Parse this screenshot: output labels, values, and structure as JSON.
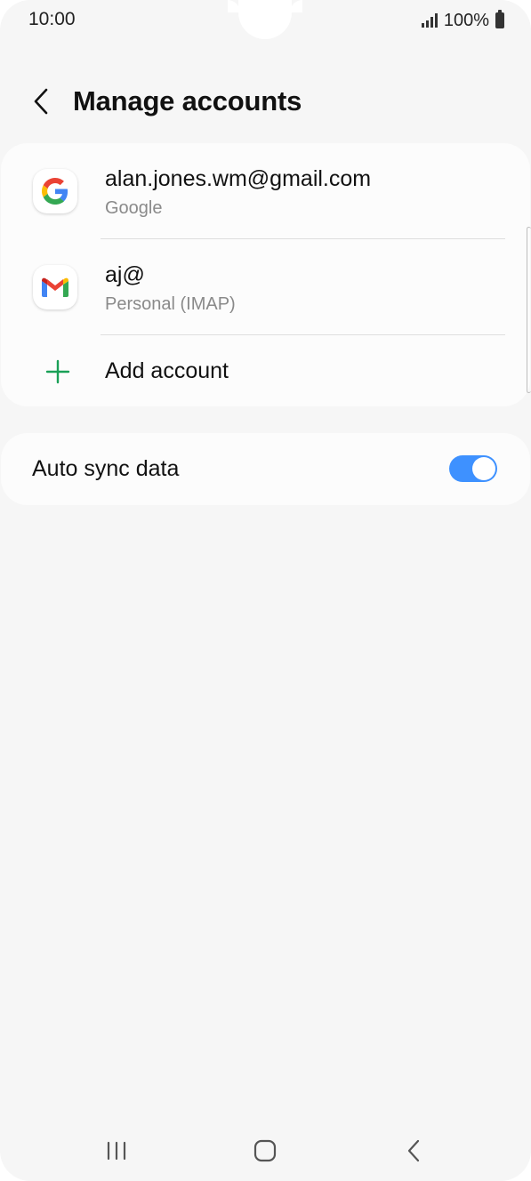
{
  "status_bar": {
    "time": "10:00",
    "battery": "100%"
  },
  "header": {
    "title": "Manage accounts",
    "back_icon": "chevron-left-icon"
  },
  "accounts": [
    {
      "title": "alan.jones.wm@gmail.com",
      "subtitle": "Google",
      "icon": "google-icon"
    },
    {
      "title": "aj@",
      "subtitle": "Personal (IMAP)",
      "icon": "gmail-icon"
    }
  ],
  "add_account": {
    "label": "Add account",
    "icon": "plus-icon"
  },
  "auto_sync": {
    "label": "Auto sync data",
    "enabled": true
  },
  "navigation": {
    "recents_icon": "recents-icon",
    "home_icon": "home-icon",
    "back_icon": "back-icon"
  },
  "colors": {
    "accent": "#3e91ff",
    "add_icon": "#1aa057",
    "background": "#f6f6f6",
    "card": "#fcfcfc"
  }
}
